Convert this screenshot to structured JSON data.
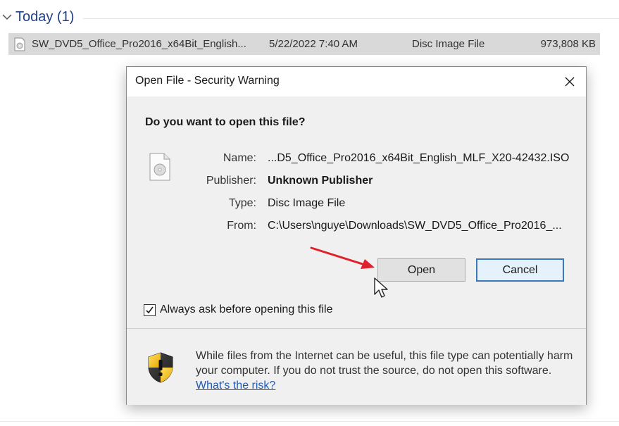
{
  "explorer": {
    "group_title": "Today (1)",
    "file": {
      "name": "SW_DVD5_Office_Pro2016_x64Bit_English...",
      "date": "5/22/2022 7:40 AM",
      "type": "Disc Image File",
      "size": "973,808 KB"
    }
  },
  "dialog": {
    "title": "Open File - Security Warning",
    "question": "Do you want to open this file?",
    "fields": {
      "name_label": "Name:",
      "name_value": "...D5_Office_Pro2016_x64Bit_English_MLF_X20-42432.ISO",
      "publisher_label": "Publisher:",
      "publisher_value": "Unknown Publisher",
      "type_label": "Type:",
      "type_value": "Disc Image File",
      "from_label": "From:",
      "from_value": "C:\\Users\\nguye\\Downloads\\SW_DVD5_Office_Pro2016_..."
    },
    "buttons": {
      "open": "Open",
      "cancel": "Cancel"
    },
    "checkbox": {
      "label": "Always ask before opening this file",
      "checked": true
    },
    "warning": {
      "text": "While files from the Internet can be useful, this file type can potentially harm your computer. If you do not trust the source, do not open this software.",
      "link": "What's the risk?"
    }
  },
  "icons": {
    "group_chevron": "chevron-down-icon",
    "file_icon": "disc-file-icon",
    "close": "close-icon",
    "disc": "disc-file-icon",
    "shield": "shield-warning-icon",
    "arrow": "red-arrow-annotation",
    "cursor": "mouse-cursor"
  },
  "colors": {
    "group_title": "#1e3f8a",
    "selected_row": "#d9d9d9",
    "dialog_bg": "#f0f0f0",
    "cancel_border": "#3c78b9",
    "link": "#1f5bb4",
    "arrow": "#e0202a"
  }
}
